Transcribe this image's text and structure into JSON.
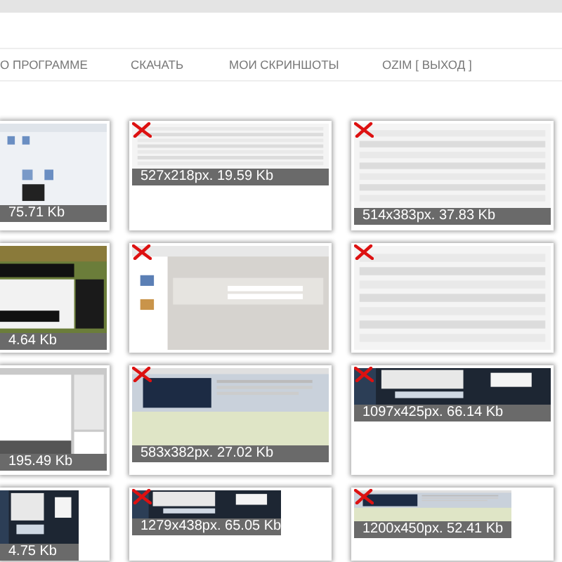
{
  "nav": [
    {
      "label": "О ПРОГРАММЕ"
    },
    {
      "label": "СКАЧАТЬ"
    },
    {
      "label": "МОИ СКРИНШОТЫ"
    },
    {
      "label": "OZIM [ ВЫХОД ]"
    }
  ],
  "screenshots": [
    {
      "kind": "picture",
      "caption": "75.71 Kb"
    },
    {
      "kind": "picture",
      "caption": "527x218px. 19.59 Kb"
    },
    {
      "kind": "picture",
      "caption": "514x383px. 37.83 Kb"
    },
    {
      "kind": "picture",
      "caption": "4.64 Kb"
    },
    {
      "kind": "picture"
    },
    {
      "kind": "picture"
    },
    {
      "kind": "picture",
      "caption": "195.49 Kb"
    },
    {
      "kind": "picture",
      "caption": "583x382px. 27.02 Kb"
    },
    {
      "kind": "picture",
      "caption": "1097x425px. 66.14 Kb"
    },
    {
      "kind": "picture",
      "caption": "4.75 Kb"
    },
    {
      "kind": "picture",
      "caption": "1279x438px. 65.05 Kb"
    },
    {
      "kind": "picture",
      "caption": "1200x450px. 52.41 Kb"
    }
  ]
}
